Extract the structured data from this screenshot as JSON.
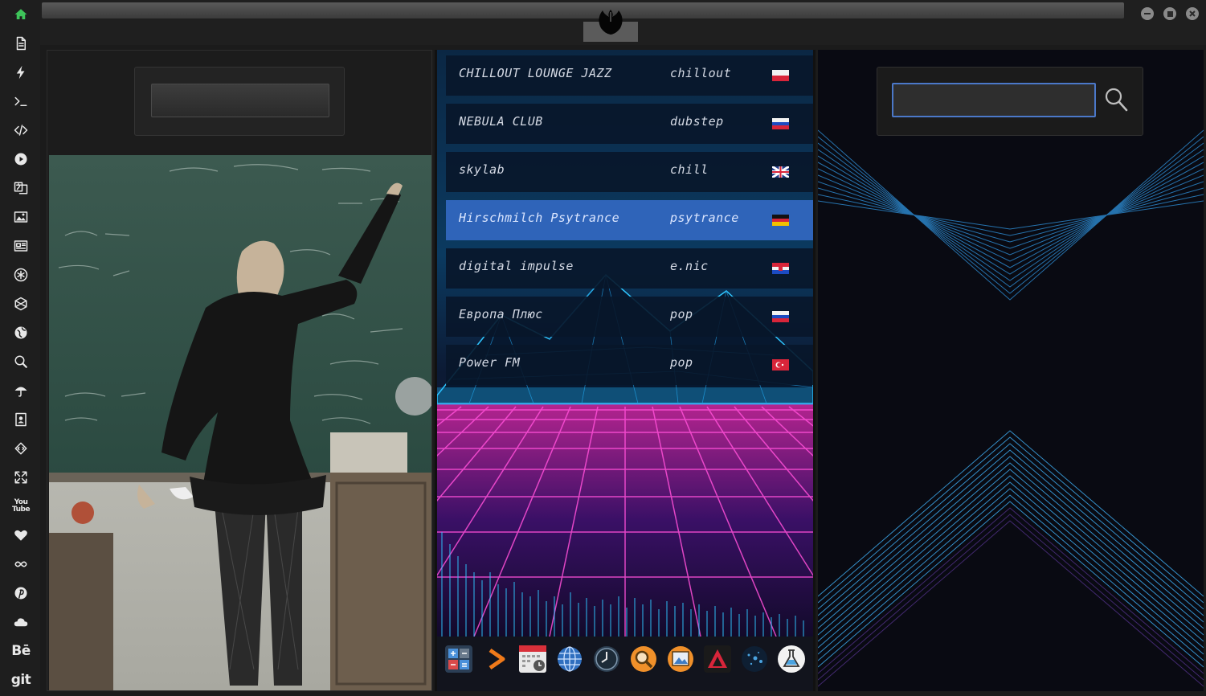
{
  "sidebar": {
    "items": [
      {
        "icon": "home-icon",
        "label": ""
      },
      {
        "icon": "document-icon",
        "label": ""
      },
      {
        "icon": "lightning-icon",
        "label": ""
      },
      {
        "icon": "terminal-icon",
        "label": ""
      },
      {
        "icon": "code-icon",
        "label": ""
      },
      {
        "icon": "play-icon",
        "label": ""
      },
      {
        "icon": "translate-icon",
        "label": ""
      },
      {
        "icon": "image-icon",
        "label": ""
      },
      {
        "icon": "news-icon",
        "label": ""
      },
      {
        "icon": "aperture-icon",
        "label": ""
      },
      {
        "icon": "hexagon-icon",
        "label": ""
      },
      {
        "icon": "globe-icon",
        "label": ""
      },
      {
        "icon": "search-icon",
        "label": ""
      },
      {
        "icon": "umbrella-icon",
        "label": ""
      },
      {
        "icon": "contact-icon",
        "label": ""
      },
      {
        "icon": "diamond-code-icon",
        "label": ""
      },
      {
        "icon": "expand-icon",
        "label": ""
      },
      {
        "icon": "youtube-icon",
        "label": "You Tube"
      },
      {
        "icon": "heart-icon",
        "label": ""
      },
      {
        "icon": "infinity-icon",
        "label": ""
      },
      {
        "icon": "pinterest-icon",
        "label": ""
      },
      {
        "icon": "cloud-icon",
        "label": ""
      },
      {
        "icon": "behance-icon",
        "label": "Bē"
      },
      {
        "icon": "git-icon",
        "label": "git"
      }
    ],
    "active_color": "#3ec45a"
  },
  "stations": [
    {
      "name": "CHILLOUT LOUNGE JAZZ",
      "genre": "chillout",
      "flag": "poland",
      "selected": false
    },
    {
      "name": "NEBULA CLUB",
      "genre": "dubstep",
      "flag": "russia",
      "selected": false
    },
    {
      "name": "skylab",
      "genre": "chill",
      "flag": "united-kingdom",
      "selected": false
    },
    {
      "name": "Hirschmilch Psytrance",
      "genre": "psytrance",
      "flag": "germany",
      "selected": true
    },
    {
      "name": "digital impulse",
      "genre": "e.nic",
      "flag": "croatia",
      "selected": false
    },
    {
      "name": "Европа Плюс",
      "genre": "pop",
      "flag": "russia",
      "selected": false
    },
    {
      "name": "Power FM",
      "genre": "pop",
      "flag": "turkey",
      "selected": false
    }
  ],
  "dock": [
    "calculator-icon",
    "terminal-arrow-icon",
    "calendar-icon",
    "browser-globe-icon",
    "clock-icon",
    "magnifier-icon",
    "image-viewer-icon",
    "vector-app-icon",
    "space-icon",
    "lab-flask-icon"
  ],
  "search": {
    "value": "",
    "placeholder": ""
  },
  "colors": {
    "selected_row": "#2f64b9",
    "search_border": "#4b78c9",
    "grid_pink": "#ff4fd8",
    "grid_cyan": "#2fc6ff",
    "chevron": "#3aa0e0"
  }
}
